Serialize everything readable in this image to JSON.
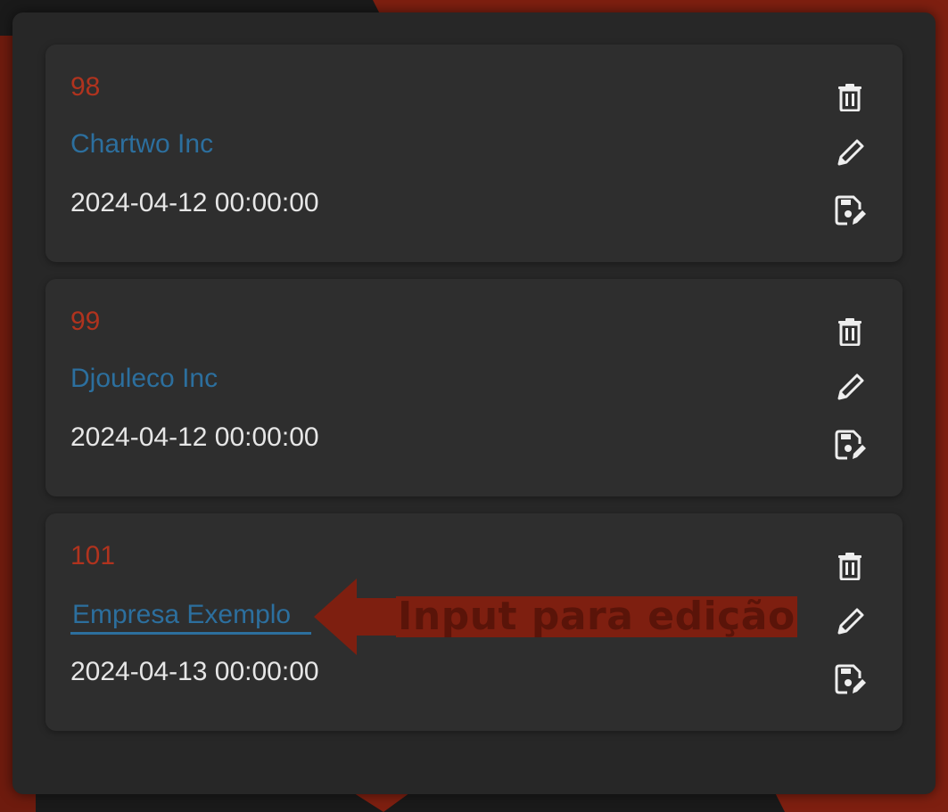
{
  "records": [
    {
      "id": "98",
      "name": "Chartwo Inc",
      "date": "2024-04-12 00:00:00",
      "editing": false
    },
    {
      "id": "99",
      "name": "Djouleco Inc",
      "date": "2024-04-12 00:00:00",
      "editing": false
    },
    {
      "id": "101",
      "name": "Empresa Exemplo",
      "date": "2024-04-13 00:00:00",
      "editing": true
    }
  ],
  "actions": [
    "trash-icon",
    "pencil-icon",
    "save-edit-icon"
  ],
  "annotation": {
    "text": "Input para edição"
  },
  "colors": {
    "id": "#b0331e",
    "name": "#2c6f9e",
    "date": "#e6e6e6",
    "card": "#2e2e2e",
    "panel": "#272727",
    "accent": "#7e1f10"
  }
}
